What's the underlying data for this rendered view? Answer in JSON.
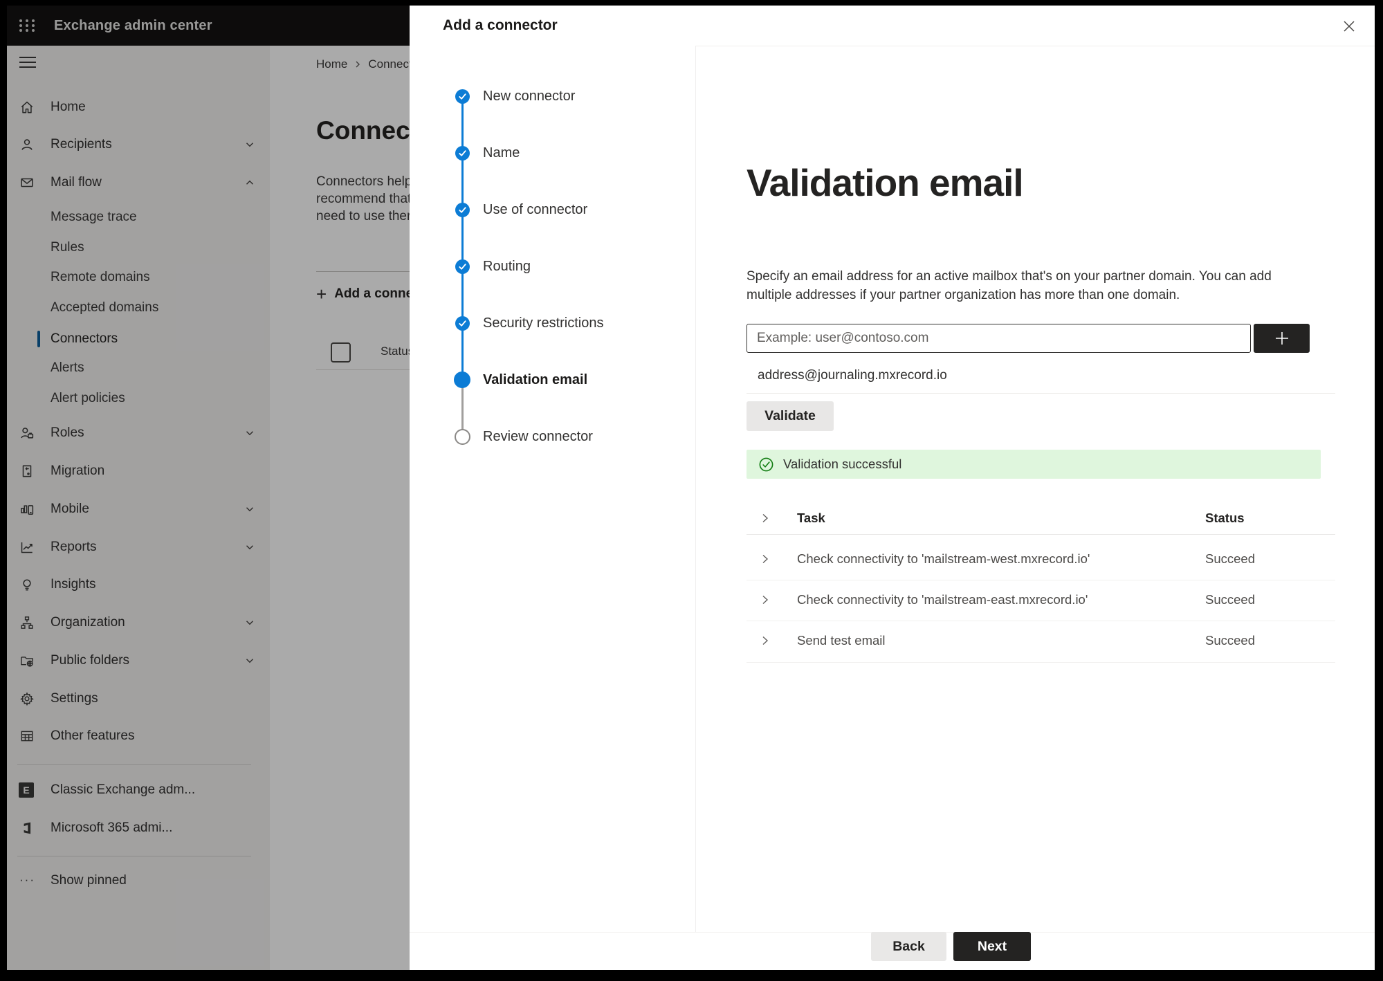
{
  "colors": {
    "accent_blue": "#0c7cd5",
    "success_green": "#107c10",
    "banner_bg": "#dff6dd",
    "dark_button": "#242322",
    "header_bg": "#141312",
    "sidebar_bg": "#f3f2f1"
  },
  "header": {
    "app_title": "Exchange admin center"
  },
  "sidebar": {
    "items": [
      {
        "label": "Home"
      },
      {
        "label": "Recipients"
      },
      {
        "label": "Mail flow"
      },
      {
        "label": "Message trace"
      },
      {
        "label": "Rules"
      },
      {
        "label": "Remote domains"
      },
      {
        "label": "Accepted domains"
      },
      {
        "label": "Connectors",
        "selected": true
      },
      {
        "label": "Alerts"
      },
      {
        "label": "Alert policies"
      },
      {
        "label": "Roles"
      },
      {
        "label": "Migration"
      },
      {
        "label": "Mobile"
      },
      {
        "label": "Reports"
      },
      {
        "label": "Insights"
      },
      {
        "label": "Organization"
      },
      {
        "label": "Public folders"
      },
      {
        "label": "Settings"
      },
      {
        "label": "Other features"
      },
      {
        "label": "Classic Exchange adm..."
      },
      {
        "label": "Microsoft 365 admi..."
      },
      {
        "label": "Show pinned"
      }
    ]
  },
  "page": {
    "breadcrumb": {
      "home": "Home",
      "current": "Connectors"
    },
    "title": "Connectors",
    "description_lines": [
      "Connectors help",
      "recommend that",
      "need to use ther"
    ],
    "add_button_label": "Add a connector",
    "status_header": "Status"
  },
  "dialog": {
    "title": "Add a connector",
    "steps": [
      {
        "label": "New connector",
        "state": "done"
      },
      {
        "label": "Name",
        "state": "done"
      },
      {
        "label": "Use of connector",
        "state": "done"
      },
      {
        "label": "Routing",
        "state": "done"
      },
      {
        "label": "Security restrictions",
        "state": "done"
      },
      {
        "label": "Validation email",
        "state": "current"
      },
      {
        "label": "Review connector",
        "state": "todo"
      }
    ],
    "content": {
      "heading": "Validation email",
      "description": "Specify an email address for an active mailbox that's on your partner domain. You can add multiple addresses if your partner organization has more than one domain.",
      "input_placeholder": "Example: user@contoso.com",
      "added_address": "address@journaling.mxrecord.io",
      "validate_label": "Validate",
      "banner_text": "Validation successful",
      "table": {
        "task_header": "Task",
        "status_header": "Status",
        "rows": [
          {
            "task": "Check connectivity to 'mailstream-west.mxrecord.io'",
            "status": "Succeed"
          },
          {
            "task": "Check connectivity to 'mailstream-east.mxrecord.io'",
            "status": "Succeed"
          },
          {
            "task": "Send test email",
            "status": "Succeed"
          }
        ]
      }
    },
    "footer": {
      "back_label": "Back",
      "next_label": "Next"
    }
  }
}
